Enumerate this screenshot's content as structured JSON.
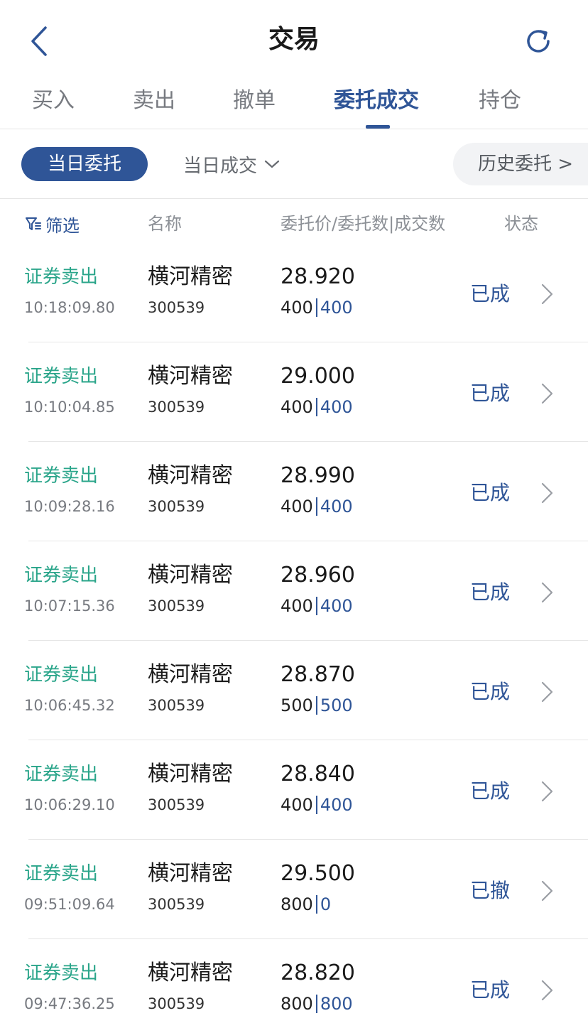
{
  "header": {
    "title": "交易",
    "back_icon": "back-chevron-icon",
    "refresh_icon": "refresh-icon"
  },
  "tabs": [
    {
      "label": "买入",
      "active": false
    },
    {
      "label": "卖出",
      "active": false
    },
    {
      "label": "撤单",
      "active": false
    },
    {
      "label": "委托成交",
      "active": true
    },
    {
      "label": "持仓",
      "active": false
    }
  ],
  "filter_bar": {
    "today_orders": "当日委托",
    "today_deals": "当日成交",
    "history": "历史委托 >"
  },
  "columns": {
    "filter": "筛选",
    "name": "名称",
    "price_qty": "委托价/委托数|成交数",
    "status": "状态"
  },
  "colors": {
    "accent": "#2f5597",
    "sell_green": "#2aa58a",
    "divider": "#e6e6e6",
    "muted": "#777a80"
  },
  "orders": [
    {
      "op": "证券卖出",
      "time": "10:18:09.80",
      "name": "横河精密",
      "code": "300539",
      "price": "28.920",
      "order_qty": "400",
      "deal_qty": "400",
      "status": "已成"
    },
    {
      "op": "证券卖出",
      "time": "10:10:04.85",
      "name": "横河精密",
      "code": "300539",
      "price": "29.000",
      "order_qty": "400",
      "deal_qty": "400",
      "status": "已成"
    },
    {
      "op": "证券卖出",
      "time": "10:09:28.16",
      "name": "横河精密",
      "code": "300539",
      "price": "28.990",
      "order_qty": "400",
      "deal_qty": "400",
      "status": "已成"
    },
    {
      "op": "证券卖出",
      "time": "10:07:15.36",
      "name": "横河精密",
      "code": "300539",
      "price": "28.960",
      "order_qty": "400",
      "deal_qty": "400",
      "status": "已成"
    },
    {
      "op": "证券卖出",
      "time": "10:06:45.32",
      "name": "横河精密",
      "code": "300539",
      "price": "28.870",
      "order_qty": "500",
      "deal_qty": "500",
      "status": "已成"
    },
    {
      "op": "证券卖出",
      "time": "10:06:29.10",
      "name": "横河精密",
      "code": "300539",
      "price": "28.840",
      "order_qty": "400",
      "deal_qty": "400",
      "status": "已成"
    },
    {
      "op": "证券卖出",
      "time": "09:51:09.64",
      "name": "横河精密",
      "code": "300539",
      "price": "29.500",
      "order_qty": "800",
      "deal_qty": "0",
      "status": "已撤"
    },
    {
      "op": "证券卖出",
      "time": "09:47:36.25",
      "name": "横河精密",
      "code": "300539",
      "price": "28.820",
      "order_qty": "800",
      "deal_qty": "800",
      "status": "已成"
    }
  ]
}
